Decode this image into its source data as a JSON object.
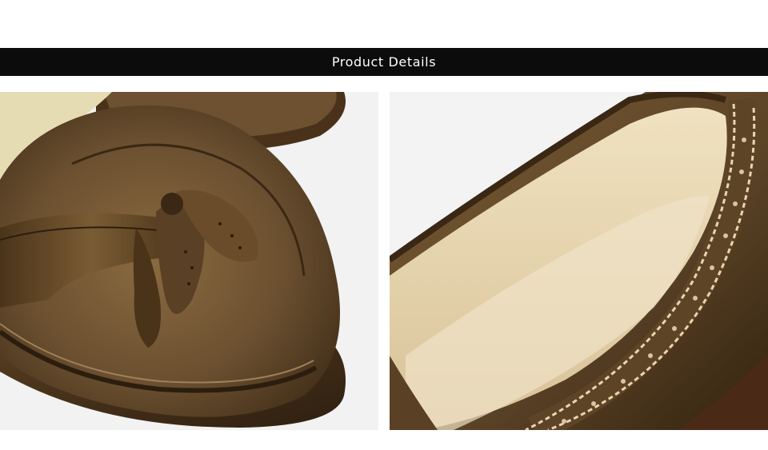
{
  "header": {
    "title": "Product Details"
  },
  "photos": [
    {
      "name": "tassel-loafer-toe-closeup"
    },
    {
      "name": "brogue-loafer-insole-closeup"
    }
  ],
  "colors": {
    "leather_dark": "#3d2b16",
    "leather_mid": "#6b5030",
    "leather_light": "#8a6a40",
    "lining": "#e8d8b8",
    "sole": "#4a321c",
    "banner": "#0c0c0c"
  }
}
